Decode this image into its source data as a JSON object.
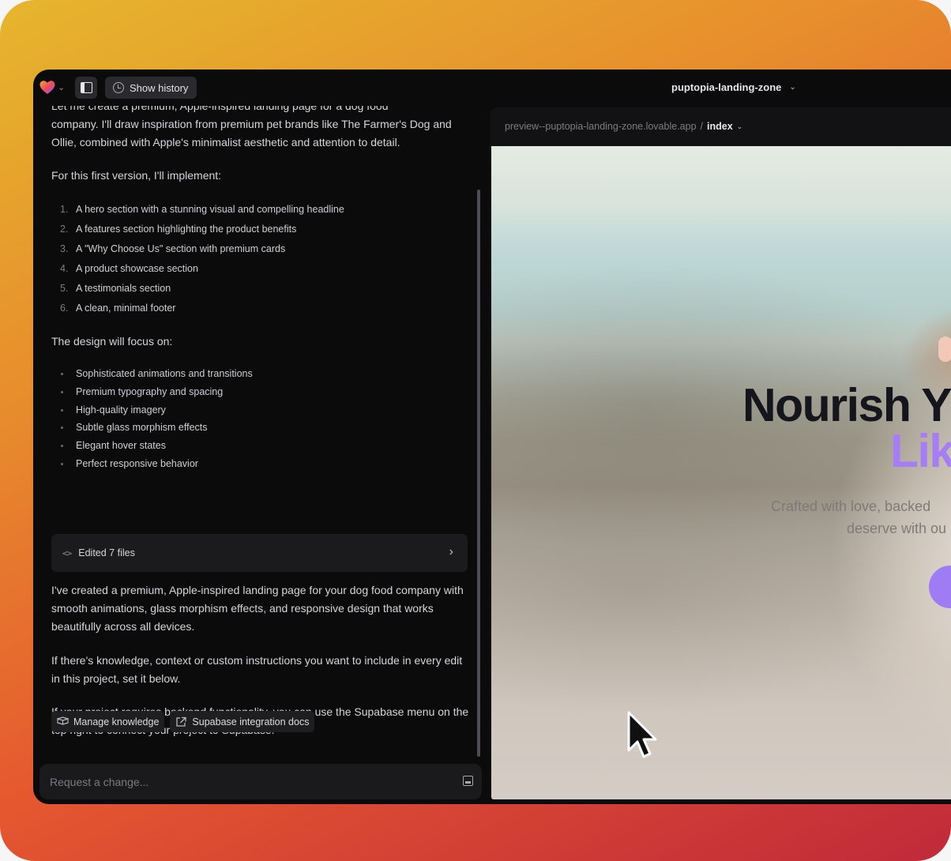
{
  "topbar": {
    "logo_icon": "heart-logo",
    "history_label": "Show history",
    "project_name": "puptopia-landing-zone"
  },
  "chat": {
    "intro_partial": "Let me create a premium, Apple-inspired landing page for a dog food",
    "intro_rest": "company. I'll draw inspiration from premium pet brands like The Farmer's Dog and Ollie, combined with Apple's minimalist aesthetic and attention to detail.",
    "implement_heading": "For this first version, I'll implement:",
    "steps": [
      {
        "num": "1.",
        "text": "A hero section with a stunning visual and compelling headline"
      },
      {
        "num": "2.",
        "text": "A features section highlighting the product benefits"
      },
      {
        "num": "3.",
        "text": "A \"Why Choose Us\" section with premium cards"
      },
      {
        "num": "4.",
        "text": "A product showcase section"
      },
      {
        "num": "5.",
        "text": "A testimonials section"
      },
      {
        "num": "6.",
        "text": "A clean, minimal footer"
      }
    ],
    "focus_heading": "The design will focus on:",
    "focus_items": [
      "Sophisticated animations and transitions",
      "Premium typography and spacing",
      "High-quality imagery",
      "Subtle glass morphism effects",
      "Elegant hover states",
      "Perfect responsive behavior"
    ],
    "edited_label": "Edited 7 files",
    "summary": "I've created a premium, Apple-inspired landing page for your dog food company with smooth animations, glass morphism effects, and responsive design that works beautifully across all devices.",
    "knowledge_note": "If there's knowledge, context or custom instructions you want to include in every edit in this project, set it below.",
    "supabase_note": "If your project requires backend functionality, you can use the Supabase menu on the top right to connect your project to Supabase.",
    "chip_manage": "Manage knowledge",
    "chip_docs": "Supabase integration docs"
  },
  "input": {
    "placeholder": "Request a change..."
  },
  "preview": {
    "url_host": "preview--puptopia-landing-zone.lovable.app",
    "url_sep": "/",
    "route": "index",
    "hero_title_visible": "Nourish Y",
    "hero_title_accent_visible": "Lik",
    "hero_sub_line1": "Crafted with love, backed",
    "hero_sub_line2": "deserve with ou"
  },
  "colors": {
    "background_gradient": [
      "#e6b62d",
      "#e78c2d",
      "#e5582f",
      "#c02a3a"
    ],
    "window_bg": "#0b0b0c",
    "accent_purple": "#a57ef6"
  }
}
